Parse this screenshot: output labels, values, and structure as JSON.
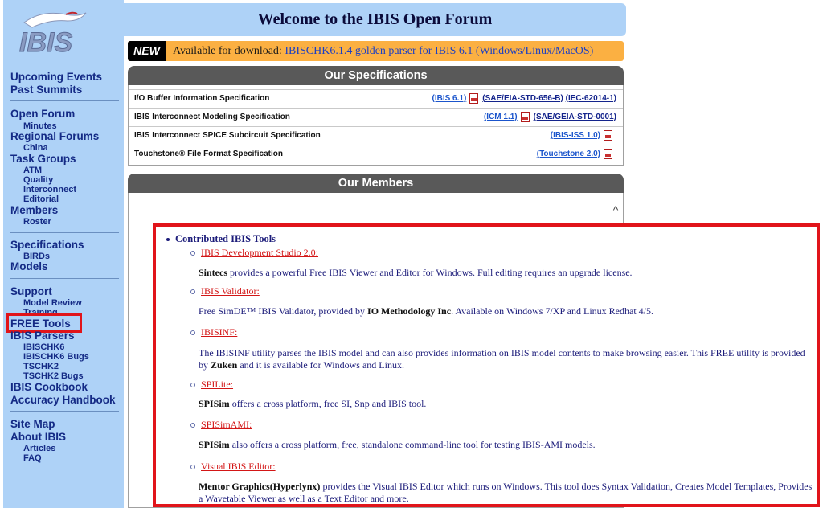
{
  "logo": {
    "text": "IBIS"
  },
  "header": {
    "title": "Welcome to the IBIS Open Forum"
  },
  "banner": {
    "badge": "NEW",
    "text": "Available for download:",
    "link": "IBISCHK6.1.4 golden parser for IBIS 6.1 (Windows/Linux/MacOS)"
  },
  "nav": {
    "upcoming_events": "Upcoming Events",
    "past_summits": "Past Summits",
    "open_forum": "Open Forum",
    "minutes": "Minutes",
    "regional_forums": "Regional Forums",
    "china": "China",
    "task_groups": "Task Groups",
    "atm": "ATM",
    "quality": "Quality",
    "interconnect": "Interconnect",
    "editorial": "Editorial",
    "members": "Members",
    "roster": "Roster",
    "specifications": "Specifications",
    "birds": "BIRDs",
    "models": "Models",
    "support": "Support",
    "model_review": "Model Review",
    "training": "Training",
    "free_tools": "FREE Tools",
    "ibis_parsers": "IBIS Parsers",
    "ibischk6": "IBISCHK6",
    "ibischk6_bugs": "IBISCHK6 Bugs",
    "tschk2": "TSCHK2",
    "tschk2_bugs": "TSCHK2 Bugs",
    "ibis_cookbook": "IBIS Cookbook",
    "accuracy_handbook": "Accuracy Handbook",
    "site_map": "Site Map",
    "about_ibis": "About IBIS",
    "articles": "Articles",
    "faq": "FAQ"
  },
  "specs": {
    "heading": "Our Specifications",
    "rows": [
      {
        "name": "I/O Buffer Information Specification",
        "link1": "(IBIS 6.1)",
        "link2": "(SAE/EIA-STD-656-B)",
        "link3": "(IEC-62014-1)"
      },
      {
        "name": "IBIS Interconnect Modeling Specification",
        "link1": "(ICM 1.1)",
        "link2": "(SAE/GEIA-STD-0001)"
      },
      {
        "name": "IBIS Interconnect SPICE Subcircuit Specification",
        "link1": "(IBIS-ISS 1.0)"
      },
      {
        "name": "Touchstone® File Format Specification",
        "link1": "(Touchstone 2.0)"
      }
    ]
  },
  "members": {
    "heading": "Our Members",
    "scroll_up": "^"
  },
  "tools": {
    "heading": "Contributed IBIS Tools",
    "items": [
      {
        "title": "IBIS Development Studio 2.0:",
        "vendor": "Sintecs",
        "desc": " provides a powerful Free IBIS Viewer and Editor for Windows. Full editing requires an upgrade license."
      },
      {
        "title": "IBIS Validator:",
        "desc_pre": "Free SimDE™ IBIS Validator, provided by ",
        "vendor": "IO Methodology Inc",
        "desc": ". Available on Windows 7/XP and Linux Redhat 4/5."
      },
      {
        "title": "IBISINF:",
        "desc_pre": "The IBISINF utility parses the IBIS model and can also provides information on IBIS model contents to make browsing easier. This FREE utility is provided by ",
        "vendor": "Zuken",
        "desc": " and it is available for Windows and Linux."
      },
      {
        "title": "SPILite:",
        "vendor": "SPISim",
        "desc": " offers a cross platform, free SI, Snp and IBIS tool."
      },
      {
        "title": "SPISimAMI:",
        "vendor": "SPISim",
        "desc": " also offers a cross platform, free, standalone command-line tool for testing IBIS-AMI models."
      },
      {
        "title": "Visual IBIS Editor:",
        "vendor": "Mentor Graphics(Hyperlynx)",
        "desc": " provides the Visual IBIS Editor which runs on Windows. This tool does Syntax Validation, Creates Model Templates, Provides a Wavetable Viewer as well as a Text Editor and more."
      }
    ]
  }
}
